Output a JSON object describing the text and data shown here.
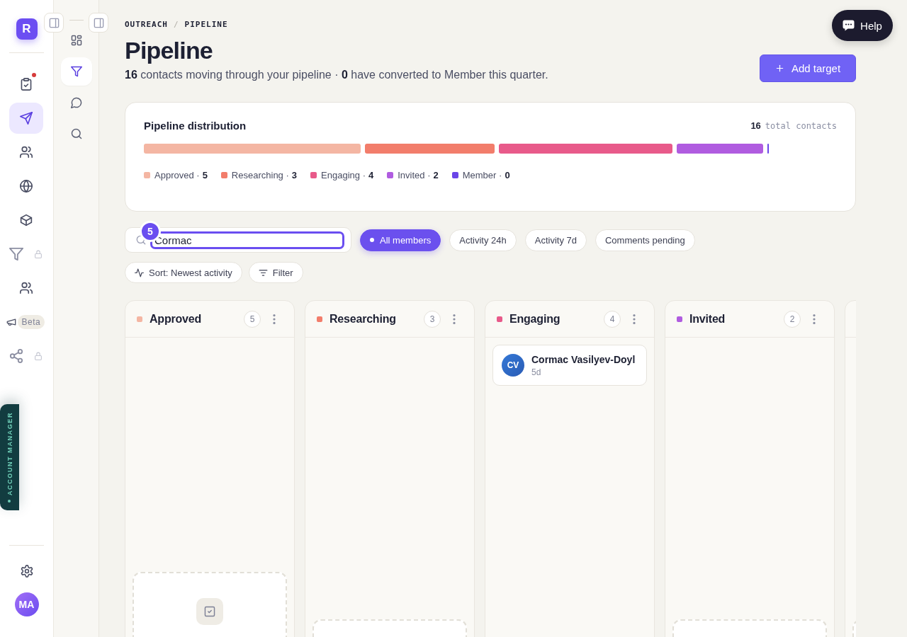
{
  "sidebar": {
    "logo": "R",
    "items": [
      {
        "selected": false,
        "notification": true,
        "locked": false
      },
      {
        "selected": true,
        "notification": false,
        "locked": false
      },
      {
        "selected": false,
        "notification": false,
        "locked": false
      },
      {
        "selected": false,
        "notification": false,
        "locked": false
      },
      {
        "selected": false,
        "notification": false,
        "locked": false
      },
      {
        "selected": false,
        "notification": false,
        "locked": true
      },
      {
        "selected": false,
        "notification": false,
        "locked": false
      },
      {
        "selected": false,
        "notification": false,
        "locked": false,
        "badge": "Beta"
      },
      {
        "selected": false,
        "notification": false,
        "locked": true
      }
    ],
    "account_manager": "ACCOUNT MANAGER",
    "avatar": "MA"
  },
  "subnav": {
    "items": [
      {
        "selected": false
      },
      {
        "selected": true
      },
      {
        "selected": false
      },
      {
        "selected": false
      }
    ]
  },
  "help": {
    "label": "Help"
  },
  "header": {
    "breadcrumb": {
      "items": [
        "OUTREACH",
        "PIPELINE"
      ],
      "separator": "/"
    },
    "title": "Pipeline",
    "subtitle": "**16** contacts moving through your pipeline · **0** have converted to Member this quarter.",
    "action": "Add target"
  },
  "distribution": {
    "title": "Pipeline distribution",
    "total": "16",
    "total_label": "total contacts",
    "separator": "·",
    "stages": [
      {
        "label": "Approved",
        "count": "5",
        "color": "#f4b6a3"
      },
      {
        "label": "Researching",
        "count": "3",
        "color": "#f27d6b"
      },
      {
        "label": "Engaging",
        "count": "4",
        "color": "#e85a8a"
      },
      {
        "label": "Invited",
        "count": "2",
        "color": "#b05ce0"
      },
      {
        "label": "Member",
        "count": "0",
        "color": "#6a45e8"
      }
    ]
  },
  "search": {
    "value": "Cormac",
    "badge": "5"
  },
  "chips": [
    {
      "label": "All members",
      "selected": true
    },
    {
      "label": "Activity 24h",
      "selected": false
    },
    {
      "label": "Activity 7d",
      "selected": false
    },
    {
      "label": "Comments pending",
      "selected": false
    }
  ],
  "actions": [
    {
      "kind": "sort",
      "label": "Sort: Newest activity"
    },
    {
      "kind": "filter",
      "label": "Filter"
    }
  ],
  "board": {
    "columns": [
      {
        "name": "Approved",
        "color": "#f4b6a3",
        "count": "5",
        "empty_state": {
          "icon": true
        }
      },
      {
        "name": "Researching",
        "color": "#f27d6b",
        "count": "3",
        "empty_state": {
          "icon": false
        }
      },
      {
        "name": "Engaging",
        "color": "#e85a8a",
        "count": "4",
        "cards": [
          {
            "initials": "CV",
            "name": "Cormac Vasilyev-Doyl",
            "age": "5d"
          }
        ]
      },
      {
        "name": "Invited",
        "color": "#b05ce0",
        "count": "2",
        "empty_state": {
          "icon": false
        }
      }
    ],
    "clipped_column": true
  }
}
